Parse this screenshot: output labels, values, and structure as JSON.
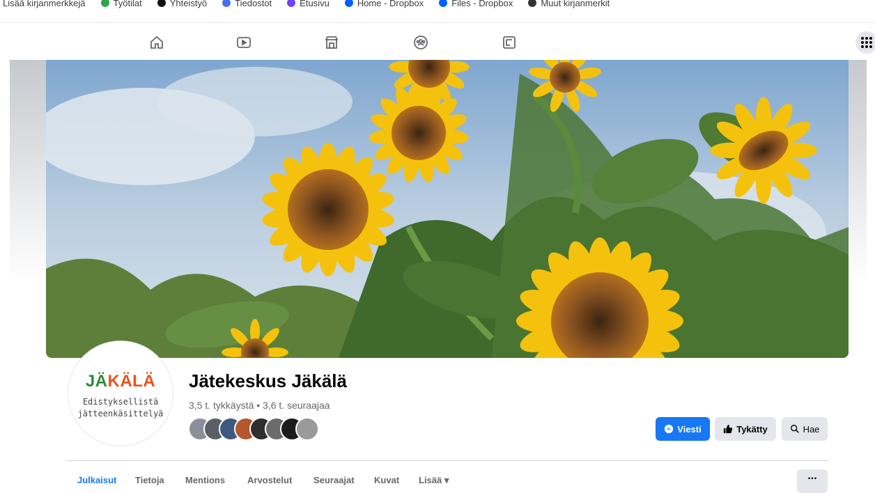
{
  "bookmarks": [
    {
      "label": "Lisää kirjanmerkkejä",
      "color": "#5f6368"
    },
    {
      "label": "Työtilat",
      "color": "#2da44e"
    },
    {
      "label": "Yhteistyö",
      "color": "#111111"
    },
    {
      "label": "Tiedostot",
      "color": "#4a6cf7"
    },
    {
      "label": "Etusivu",
      "color": "#6f42ff"
    },
    {
      "label": "Home - Dropbox",
      "color": "#0061fe"
    },
    {
      "label": "Files - Dropbox",
      "color": "#0061fe"
    },
    {
      "label": "Muut kirjanmerkit",
      "color": "#333333"
    }
  ],
  "nav": {
    "icons": [
      "home-icon",
      "watch-icon",
      "marketplace-icon",
      "groups-icon",
      "gaming-icon"
    ],
    "apps_icon": "grid-menu-icon"
  },
  "cover": {
    "description_icon": "sunflower-photo"
  },
  "profile": {
    "logo_main_1": "JÄ",
    "logo_main_2": "KÄLÄ",
    "logo_sub_1": "Edistyksellistä",
    "logo_sub_2": "jätteenkäsittelyä",
    "name": "Jätekeskus Jäkälä",
    "stats": "3,5 t. tykkäystä • 3,6 t. seuraajaa",
    "follower_count_shown": 8
  },
  "actions": {
    "message": "Viesti",
    "liked": "Tykätty",
    "search": "Hae"
  },
  "tabs": [
    {
      "label": "Julkaisut",
      "active": true
    },
    {
      "label": "Tietoja",
      "active": false
    },
    {
      "label": "Mentions",
      "active": false
    },
    {
      "label": "Arvostelut",
      "active": false
    },
    {
      "label": "Seuraajat",
      "active": false
    },
    {
      "label": "Kuvat",
      "active": false
    },
    {
      "label": "Lisää ▾",
      "active": false
    }
  ],
  "more_button": "...",
  "colors": {
    "accent": "#1877f2",
    "secondary_button": "#e4e6eb",
    "logo_green": "#2e8b3b",
    "logo_orange": "#e8531c"
  }
}
